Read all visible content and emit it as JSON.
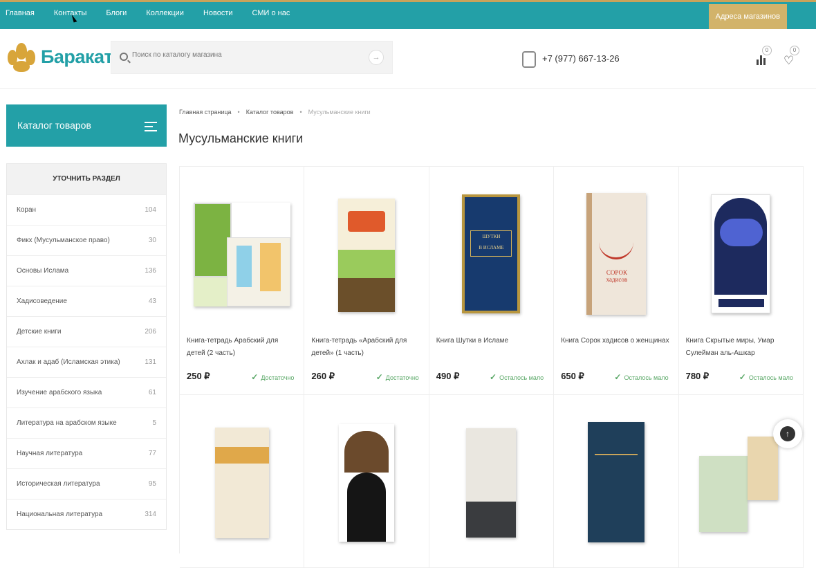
{
  "topbar": {
    "nav": [
      "Главная",
      "Контакты",
      "Блоги",
      "Коллекции",
      "Новости",
      "СМИ о нас"
    ],
    "stores_label": "Адреса магазинов"
  },
  "header": {
    "logo_text": "Баракат",
    "search_placeholder": "Поиск по каталогу магазина",
    "phone": "+7 (977) 667-13-26",
    "compare_count": "0",
    "fav_count": "0"
  },
  "catalog_button": "Каталог товаров",
  "sidebar": {
    "heading": "Уточнить раздел",
    "items": [
      {
        "label": "Коран",
        "count": "104"
      },
      {
        "label": "Фикх (Мусульманское право)",
        "count": "30"
      },
      {
        "label": "Основы Ислама",
        "count": "136"
      },
      {
        "label": "Хадисоведение",
        "count": "43"
      },
      {
        "label": "Детские книги",
        "count": "206"
      },
      {
        "label": "Ахлак и адаб (Исламская этика)",
        "count": "131"
      },
      {
        "label": "Изучение арабского языка",
        "count": "61"
      },
      {
        "label": "Литература на арабском языке",
        "count": "5"
      },
      {
        "label": "Научная литература",
        "count": "77"
      },
      {
        "label": "Историческая литература",
        "count": "95"
      },
      {
        "label": "Национальная литература",
        "count": "314"
      }
    ]
  },
  "breadcrumb": {
    "home": "Главная страница",
    "catalog": "Каталог товаров",
    "current": "Мусульманские книги"
  },
  "page_title": "Мусульманские книги",
  "products": [
    {
      "name": "Книга-тетрадь Арабский для детей (2 часть)",
      "price": "250 ₽",
      "stock": "Достаточно"
    },
    {
      "name": "Книга-тетрадь «Арабский для детей» (1 часть)",
      "price": "260 ₽",
      "stock": "Достаточно"
    },
    {
      "name": "Книга Шутки в Исламе",
      "price": "490 ₽",
      "stock": "Осталось мало"
    },
    {
      "name": "Книга Сорок хадисов о женщинах",
      "price": "650 ₽",
      "stock": "Осталось мало"
    },
    {
      "name": "Книга Скрытые миры, Умар Сулейман аль-Ашкар",
      "price": "780 ₽",
      "stock": "Осталось мало"
    }
  ],
  "colors": {
    "accent": "#23a0a7",
    "gold": "#d2b36a",
    "stock": "#5aa867"
  }
}
